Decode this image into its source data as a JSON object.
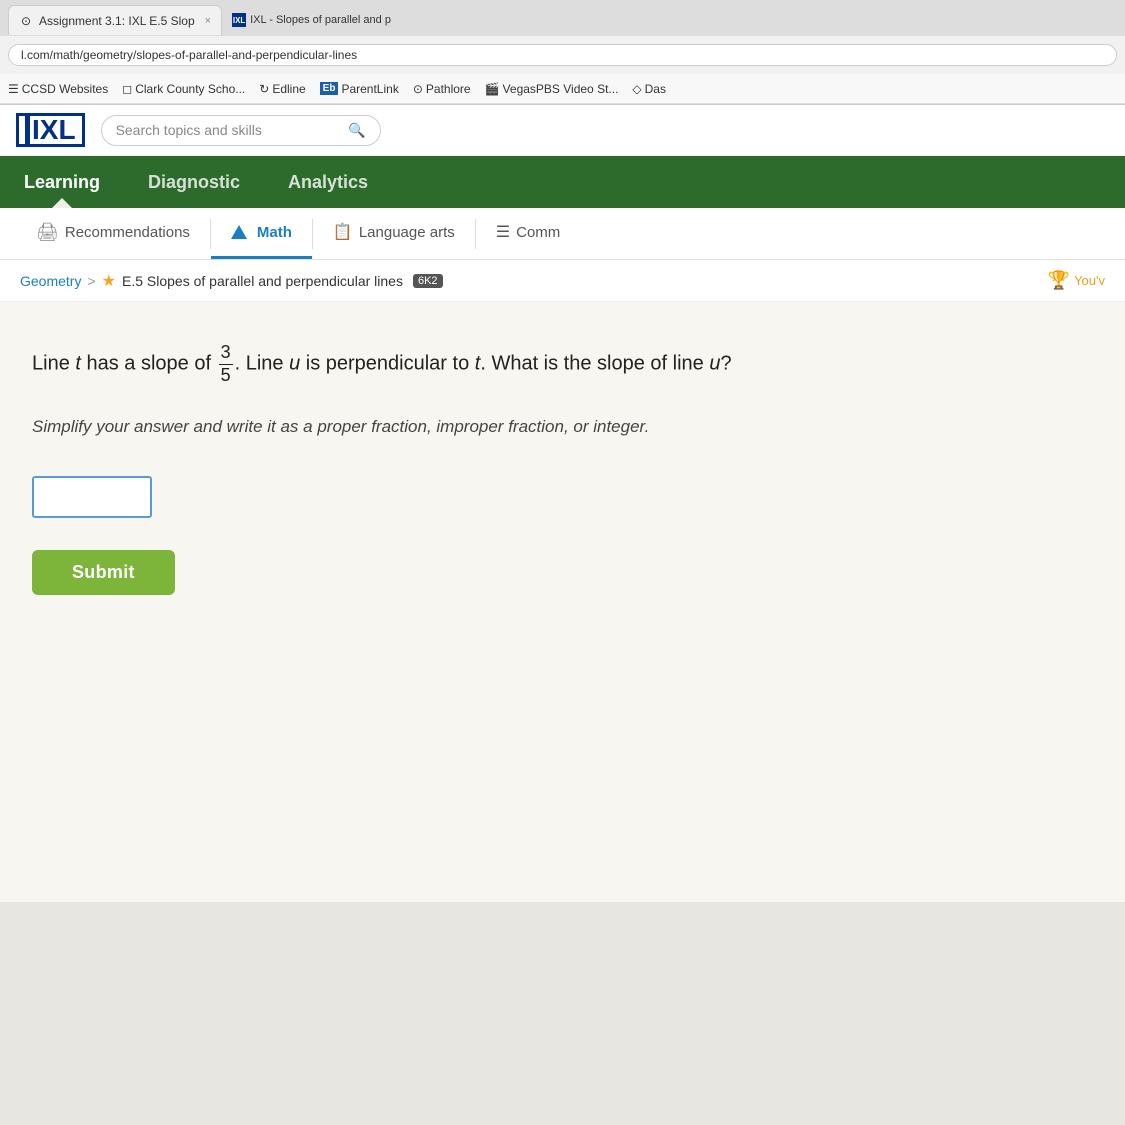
{
  "browser": {
    "url": "l.com/math/geometry/slopes-of-parallel-and-perpendicular-lines",
    "tab_active_label": "Assignment 3.1: IXL E.5 Slop",
    "tab_side_label": "IXL - Slopes of parallel and p",
    "close_icon": "×",
    "search_icon": "🔍",
    "favicon_assignment": "⊙",
    "favicon_ixl": "IXL"
  },
  "bookmarks": [
    {
      "label": "CCSD Websites",
      "icon": "☰"
    },
    {
      "label": "Clark County Scho...",
      "icon": "◻"
    },
    {
      "label": "Edline",
      "icon": "↻"
    },
    {
      "label": "ParentLink",
      "icon": "Eb"
    },
    {
      "label": "Pathlore",
      "icon": "⊙"
    },
    {
      "label": "VegasPBS Video St...",
      "icon": "🎬"
    },
    {
      "label": "Das",
      "icon": "◇"
    }
  ],
  "ixl": {
    "logo_text": "IXL",
    "search_placeholder": "Search topics and skills",
    "search_icon": "🔍"
  },
  "nav": {
    "items": [
      {
        "label": "Learning",
        "active": true
      },
      {
        "label": "Diagnostic",
        "active": false
      },
      {
        "label": "Analytics",
        "active": false
      }
    ]
  },
  "sub_nav": {
    "items": [
      {
        "label": "Recommendations",
        "active": false,
        "icon": "recommendations"
      },
      {
        "label": "Math",
        "active": true,
        "icon": "math"
      },
      {
        "label": "Language arts",
        "active": false,
        "icon": "language"
      },
      {
        "label": "Comm",
        "active": false,
        "icon": "common"
      }
    ]
  },
  "breadcrumb": {
    "parent": "Geometry",
    "separator": ">",
    "current": "E.5 Slopes of parallel and perpendicular lines",
    "badge": "6K2",
    "trophy_text": "You'v"
  },
  "question": {
    "line_t_text": "Line ",
    "line_t_var": "t",
    "has_slope_text": " has a slope of ",
    "fraction_numerator": "3",
    "fraction_denominator": "5",
    "line_u_text": ". Line ",
    "line_u_var": "u",
    "perpendicular_text": " is perpendicular to ",
    "t_var": "t",
    "question_end": ". What is the slope of line ",
    "u_var": "u",
    "question_mark": "?",
    "instruction": "Simplify your answer and write it as a proper fraction, improper fraction, or integer.",
    "submit_label": "Submit",
    "input_placeholder": ""
  }
}
